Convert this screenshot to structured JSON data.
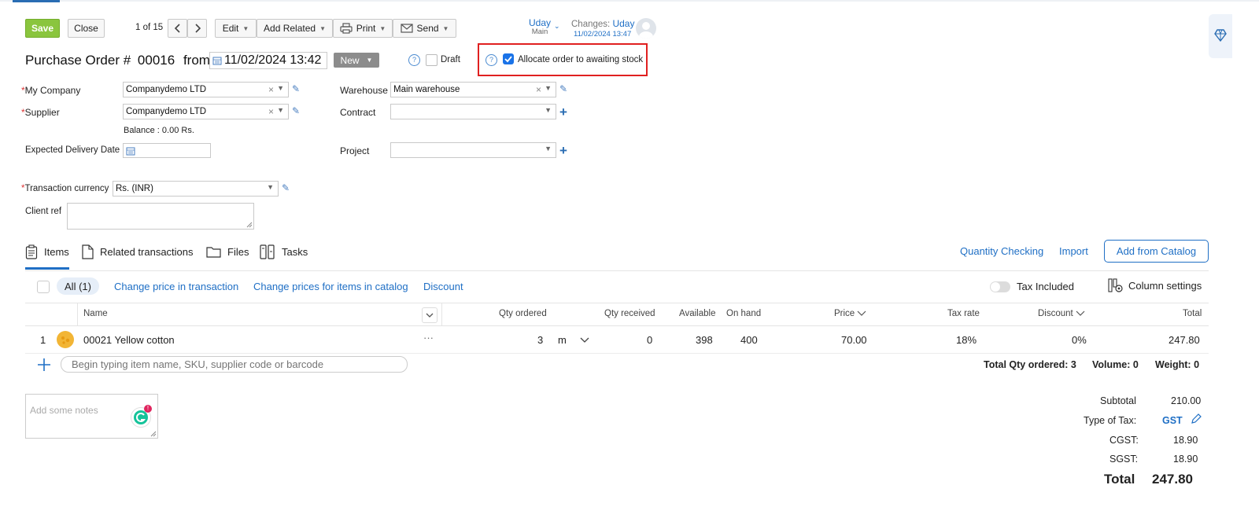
{
  "toolbar": {
    "save_label": "Save",
    "close_label": "Close",
    "pager_text": "1 of 15",
    "edit_label": "Edit",
    "add_related_label": "Add Related",
    "print_label": "Print",
    "send_label": "Send"
  },
  "user": {
    "name": "Uday",
    "location": "Main",
    "changes_label": "Changes:",
    "changes_user": "Uday",
    "changes_time": "11/02/2024 13:47"
  },
  "header": {
    "title": "Purchase Order #",
    "number": "00016",
    "from_label": "from",
    "date": "11/02/2024 13:42",
    "status": "New",
    "draft_label": "Draft",
    "allocate_label": "Allocate order to awaiting stock",
    "allocate_checked": true
  },
  "form": {
    "my_company_label": "My Company",
    "my_company_value": "Companydemo LTD",
    "supplier_label": "Supplier",
    "supplier_value": "Companydemo LTD",
    "balance_text": "Balance : 0.00 Rs.",
    "expected_delivery_label": "Expected Delivery Date",
    "warehouse_label": "Warehouse",
    "warehouse_value": "Main warehouse",
    "contract_label": "Contract",
    "project_label": "Project",
    "currency_label": "Transaction currency",
    "currency_value": "Rs. (INR)",
    "client_ref_label": "Client ref"
  },
  "tabs": {
    "items": "Items",
    "related": "Related transactions",
    "files": "Files",
    "tasks": "Tasks",
    "quantity_checking": "Quantity Checking",
    "import": "Import",
    "add_from_catalog": "Add from Catalog"
  },
  "filters": {
    "all_label": "All (1)",
    "change_price_transaction": "Change price in transaction",
    "change_prices_catalog": "Change prices for items in catalog",
    "discount": "Discount",
    "tax_included": "Tax Included",
    "column_settings": "Column settings"
  },
  "table": {
    "headers": {
      "name": "Name",
      "qty_ordered": "Qty ordered",
      "qty_received": "Qty received",
      "available": "Available",
      "on_hand": "On hand",
      "price": "Price",
      "tax_rate": "Tax rate",
      "discount": "Discount",
      "total": "Total"
    },
    "rows": [
      {
        "index": "1",
        "name": "00021 Yellow cotton",
        "more": "···",
        "qty": "3",
        "unit": "m",
        "received": "0",
        "available": "398",
        "on_hand": "400",
        "price": "70.00",
        "tax_rate": "18%",
        "discount": "0%",
        "total": "247.80"
      }
    ],
    "add_item_placeholder": "Begin typing item name, SKU, supplier code or barcode",
    "total_qty_text": "Total Qty ordered: 3",
    "volume_text": "Volume: 0",
    "weight_text": "Weight: 0"
  },
  "notes": {
    "placeholder": "Add some notes"
  },
  "summary": {
    "subtotal_label": "Subtotal",
    "subtotal_value": "210.00",
    "tax_type_label": "Type of Tax:",
    "tax_type_value": "GST",
    "cgst_label": "CGST:",
    "cgst_value": "18.90",
    "sgst_label": "SGST:",
    "sgst_value": "18.90",
    "total_label": "Total",
    "total_value": "247.80"
  },
  "colors": {
    "accent": "#1f6fc5",
    "save_green": "#8ac53e",
    "highlight_red": "#e02020",
    "checkbox_blue": "#1a73e8"
  },
  "icons": [
    "calendar-icon",
    "pencil-icon",
    "help-icon",
    "printer-icon",
    "envelope-icon",
    "clipboard-icon",
    "document-icon",
    "folder-icon",
    "tasks-icon",
    "gear-icon",
    "diamond-icon",
    "grammarly-icon"
  ]
}
